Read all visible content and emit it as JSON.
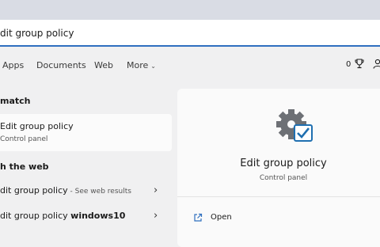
{
  "search": {
    "query": "dit group policy"
  },
  "filters": [
    {
      "label": "Apps"
    },
    {
      "label": "Documents"
    },
    {
      "label": "Web"
    },
    {
      "label": "More"
    }
  ],
  "rewards": {
    "points": "0"
  },
  "best_match": {
    "heading": "match",
    "title": "Edit group policy",
    "subtitle": "Control panel"
  },
  "web": {
    "heading": "h the web",
    "results": [
      {
        "text": "dit group policy",
        "suffix": " - See web results"
      },
      {
        "text": "dit group policy ",
        "bold": "windows10"
      }
    ]
  },
  "detail": {
    "title": "Edit group policy",
    "subtitle": "Control panel",
    "actions": [
      {
        "label": "Open"
      }
    ]
  },
  "colors": {
    "accent": "#2f6fbf",
    "checkbox": "#1f6fb0",
    "gear": "#6d7075"
  }
}
